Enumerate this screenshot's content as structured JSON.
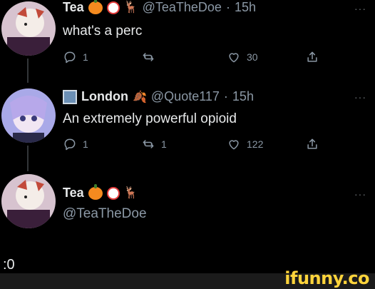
{
  "tweets": [
    {
      "name": "Tea",
      "handle": "@TeaTheDoe",
      "time": "15h",
      "text": "what's a perc",
      "replies": "1",
      "retweets": "",
      "likes": "30"
    },
    {
      "name": "London",
      "handle": "@Quote117",
      "time": "15h",
      "text": "An extremely powerful opioid",
      "replies": "1",
      "retweets": "1",
      "likes": "122"
    },
    {
      "name": "Tea",
      "handle": "@TeaTheDoe"
    }
  ],
  "separator": "·",
  "more_glyph": "···",
  "bottom_text": ":0",
  "watermark": "ifunny.co"
}
